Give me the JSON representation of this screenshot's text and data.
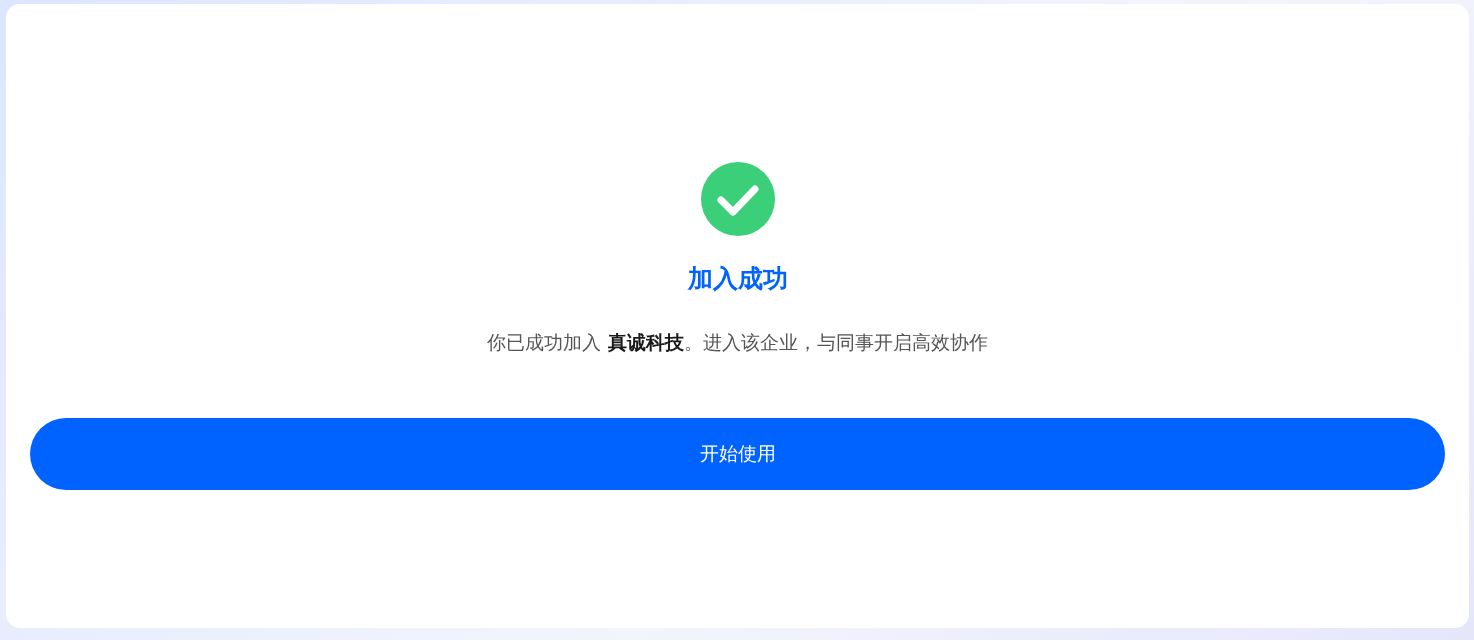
{
  "title": "加入成功",
  "message": "你已成功加入 **真诚科技**。进入该企业，与同事开启高效协作",
  "button": "开始使用"
}
